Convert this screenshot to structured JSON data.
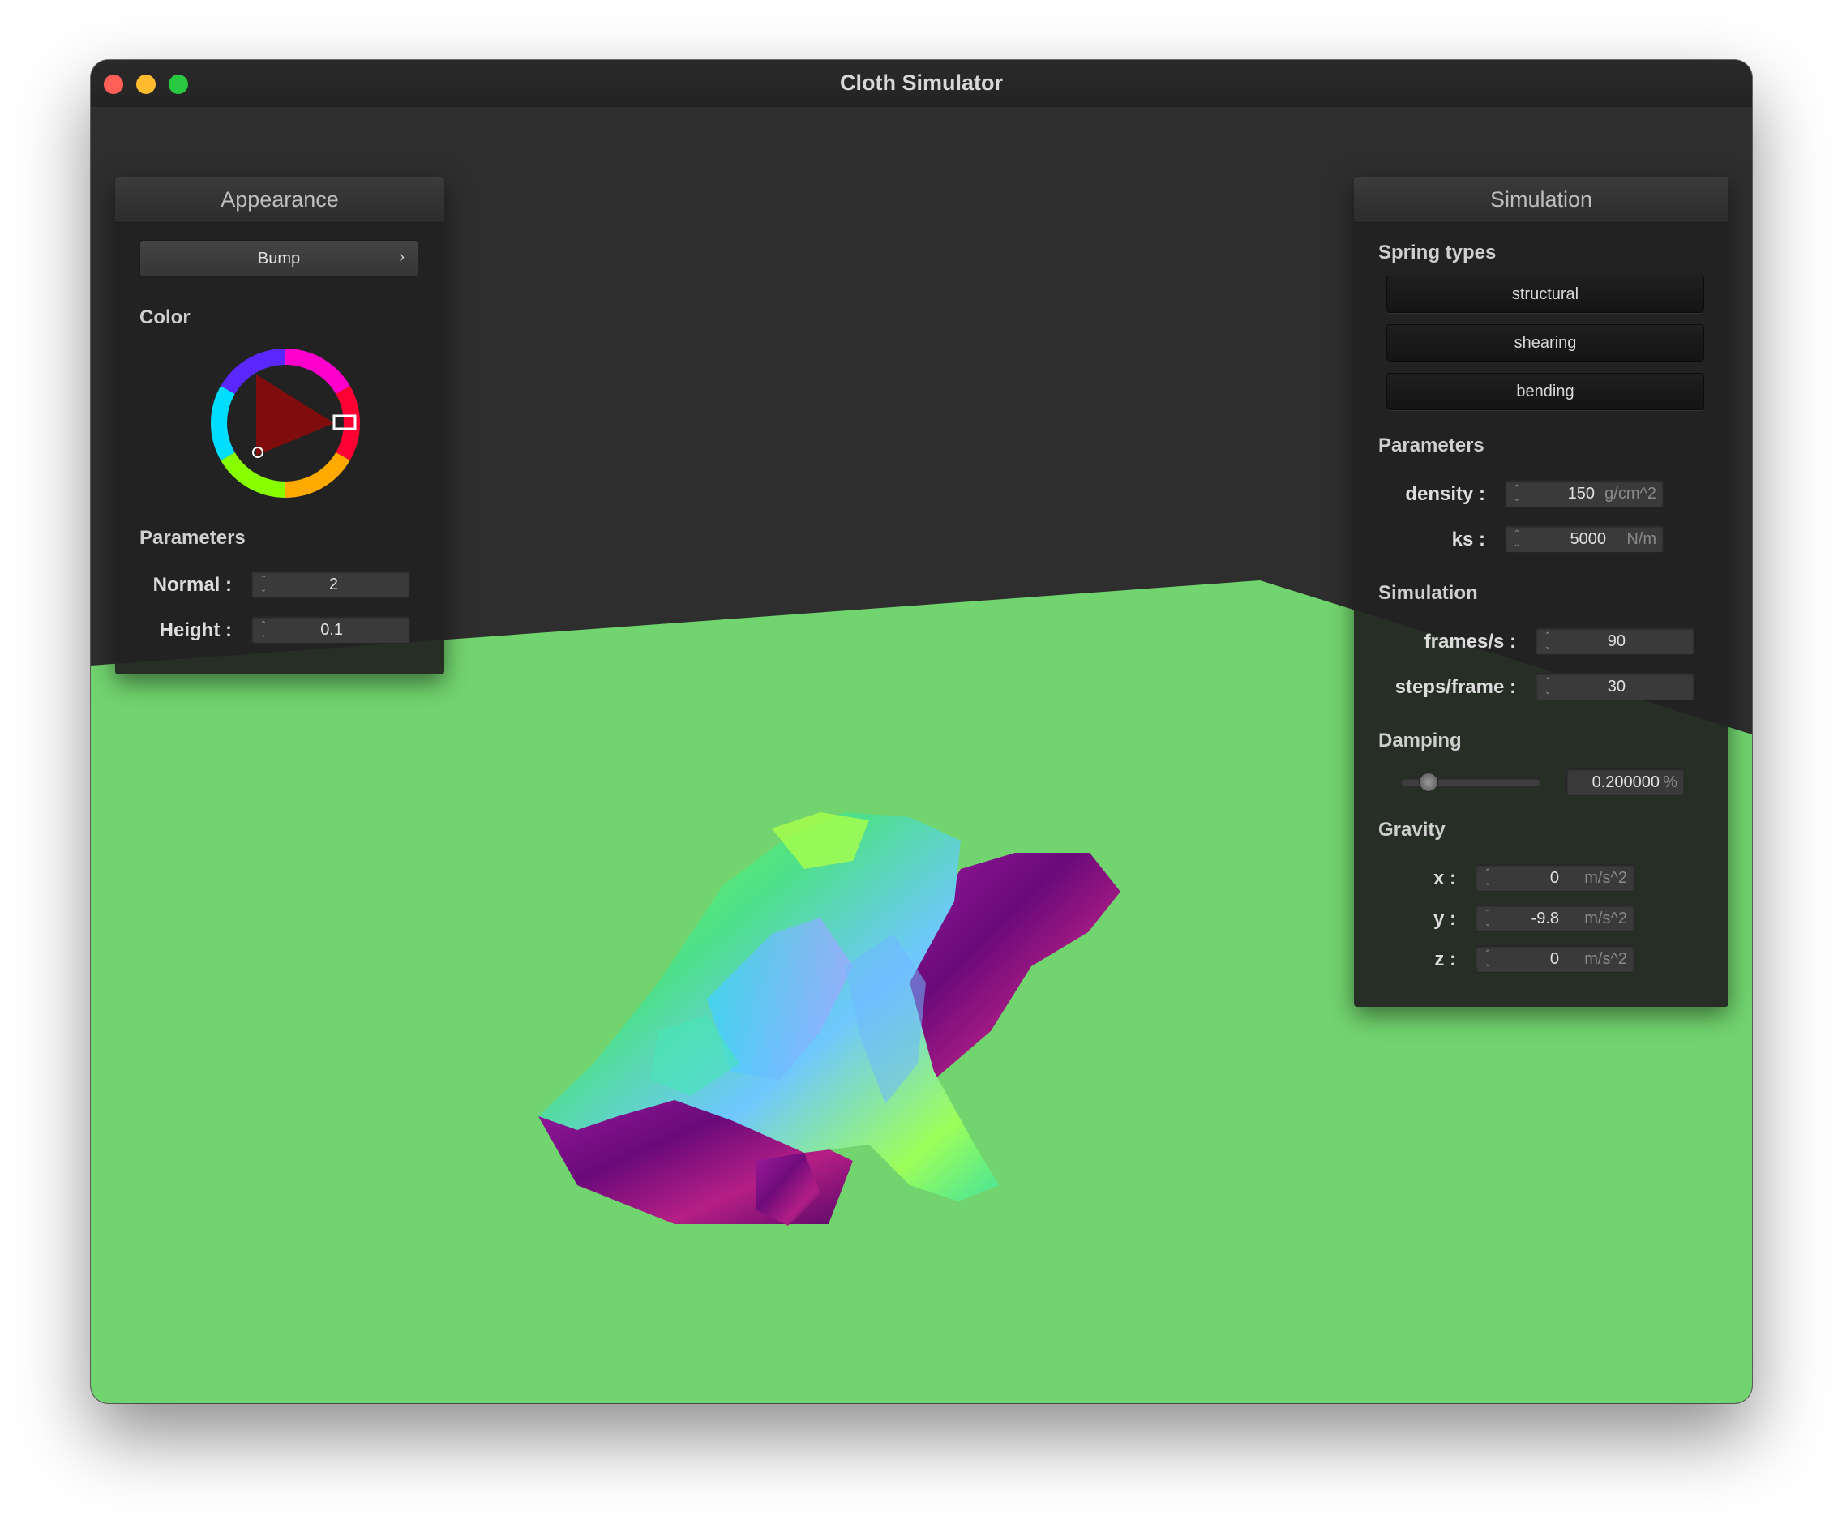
{
  "window": {
    "title": "Cloth Simulator"
  },
  "appearance": {
    "header": "Appearance",
    "shader_button": "Bump",
    "shader_chevron": "›",
    "color_label": "Color",
    "parameters_label": "Parameters",
    "normal": {
      "label": "Normal :",
      "value": "2"
    },
    "height": {
      "label": "Height :",
      "value": "0.1"
    },
    "selected_color": "#cc1111"
  },
  "simulation": {
    "header": "Simulation",
    "spring_types_label": "Spring types",
    "springs": [
      "structural",
      "shearing",
      "bending"
    ],
    "parameters_label": "Parameters",
    "density": {
      "label": "density :",
      "value": "150",
      "unit": "g/cm^2"
    },
    "ks": {
      "label": "ks :",
      "value": "5000",
      "unit": "N/m"
    },
    "sim_label": "Simulation",
    "fps": {
      "label": "frames/s :",
      "value": "90"
    },
    "steps": {
      "label": "steps/frame :",
      "value": "30"
    },
    "damping_label": "Damping",
    "damping": {
      "value": "0.200000",
      "unit": "%",
      "slider_fraction": 0.2
    },
    "gravity_label": "Gravity",
    "gravity": [
      {
        "label": "x :",
        "value": "0",
        "unit": "m/s^2"
      },
      {
        "label": "y :",
        "value": "-9.8",
        "unit": "m/s^2"
      },
      {
        "label": "z :",
        "value": "0",
        "unit": "m/s^2"
      }
    ]
  },
  "scene": {
    "floor_color": "#72d46e",
    "background_color": "#2e2e2f"
  }
}
